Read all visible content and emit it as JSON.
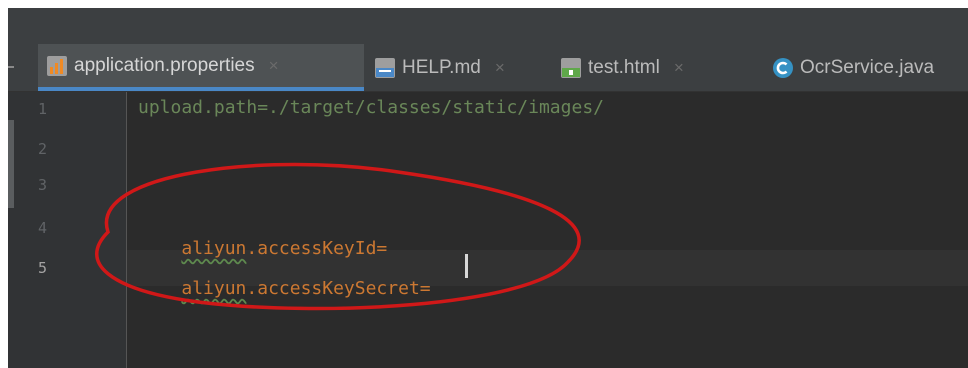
{
  "tabs": [
    {
      "label": "application.properties",
      "icon": "properties-file-icon",
      "active": true
    },
    {
      "label": "HELP.md",
      "icon": "markdown-file-icon",
      "active": false
    },
    {
      "label": "test.html",
      "icon": "html-file-icon",
      "active": false
    },
    {
      "label": "OcrService.java",
      "icon": "java-class-icon",
      "active": false
    }
  ],
  "tab_close": "×",
  "gutter": {
    "line_numbers": [
      "1",
      "2",
      "3",
      "4",
      "5"
    ],
    "current_line": "5"
  },
  "editor": {
    "line1": {
      "text": "upload.path=./target/classes/static/images/"
    },
    "line4": {
      "squiggle": "aliyun",
      "rest": ".accessKeyId="
    },
    "line5": {
      "squiggle": "aliyun",
      "rest": ".accessKeySecret="
    }
  },
  "colors": {
    "editor_bg": "#2b2b2b",
    "key": "#cc7832",
    "value": "#6a8759",
    "active_tab_underline": "#4a88c7",
    "annotation": "#d01818"
  }
}
